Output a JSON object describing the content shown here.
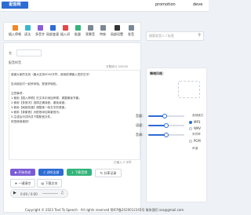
{
  "header": {
    "logo_text": "配音网",
    "nav": [
      "promotion",
      "deve"
    ]
  },
  "toolbar": {
    "items": [
      {
        "label": "插入停顿",
        "icon": "pause-icon",
        "color": "#f08a24"
      },
      {
        "label": "读法",
        "icon": "read-icon",
        "color": "#3bb6ce"
      },
      {
        "label": "多音字",
        "icon": "polyphone-icon",
        "color": "#8a5cd6"
      },
      {
        "label": "局部变速",
        "icon": "speed-icon",
        "color": "#2d6cd3"
      },
      {
        "label": "插入词",
        "icon": "word-icon",
        "color": "#e24a4a"
      },
      {
        "label": "批量",
        "icon": "batch-icon",
        "color": "#34b37a"
      },
      {
        "label": "背景音",
        "icon": "music-icon",
        "color": "#7b8794"
      },
      {
        "label": "特效",
        "icon": "effect-icon",
        "color": "#7b8794"
      },
      {
        "label": "局部设置",
        "icon": "settings-icon",
        "color": "#333333"
      },
      {
        "label": "发音",
        "icon": "speaker-icon",
        "color": "#7b8794"
      }
    ]
  },
  "search": {
    "placeholder": "搜索发音人 / 标签",
    "button_icon": "search-icon"
  },
  "editor": {
    "title_label": "名",
    "subtitle_label": "配音样音",
    "char_count": "字数统计 0/5000",
    "paragraphs": [
      "感谢大家的支持（最大支持5000字符，使用前请输入您的文字）",
      "告诉朋友们一起来体验，配音好轻松。",
      "注意事项：",
      "1.使用【插入停顿】在文本中添加停顿，调整朗读节奏；",
      "2.使用【多音字】选择正确读音，避免读错；",
      "3.使用【局部变速】调整某一段文字的语速；",
      "4.使用【背景音】为配音添加背景音乐；",
      "5.生成后可试听并下载配音文件。",
      "祝您使用愉快！"
    ],
    "hint": "已输入 0 字符",
    "buttons": [
      {
        "label": "开始合成",
        "color": "#7a5cd6",
        "icon": "play-icon"
      },
      {
        "label": "试听全部",
        "color": "#2d6cd3",
        "icon": "headphone-icon"
      },
      {
        "label": "下载音频",
        "color": "#34b37a",
        "icon": "download-icon"
      },
      {
        "label": "分享记录",
        "color": "#ffffff",
        "icon": "share-icon"
      }
    ],
    "secondary": [
      {
        "label": "一键清空",
        "icon": "clear-icon"
      },
      {
        "label": "下载文本",
        "icon": "text-icon"
      }
    ],
    "player_time": "0:00 / 0:00"
  },
  "voice": {
    "section_title": "情绪风格：",
    "sliders": [
      {
        "label": "音量：",
        "value": 0.45
      },
      {
        "label": "语速：",
        "value": 0.5
      },
      {
        "label": "音调：",
        "value": 0.5
      }
    ],
    "formats": [
      {
        "label": "MP3",
        "selected": true
      },
      {
        "label": "WAV",
        "selected": false
      },
      {
        "label": "PCM",
        "selected": false
      }
    ],
    "side_labels": [
      "音频格式",
      "采样率",
      "声道"
    ]
  },
  "footer": {
    "text": "Copyright © 2023 Text To Speech · All rights reserved  鄂ICP备2020012345号  联系我们 sss@gmail.com"
  }
}
